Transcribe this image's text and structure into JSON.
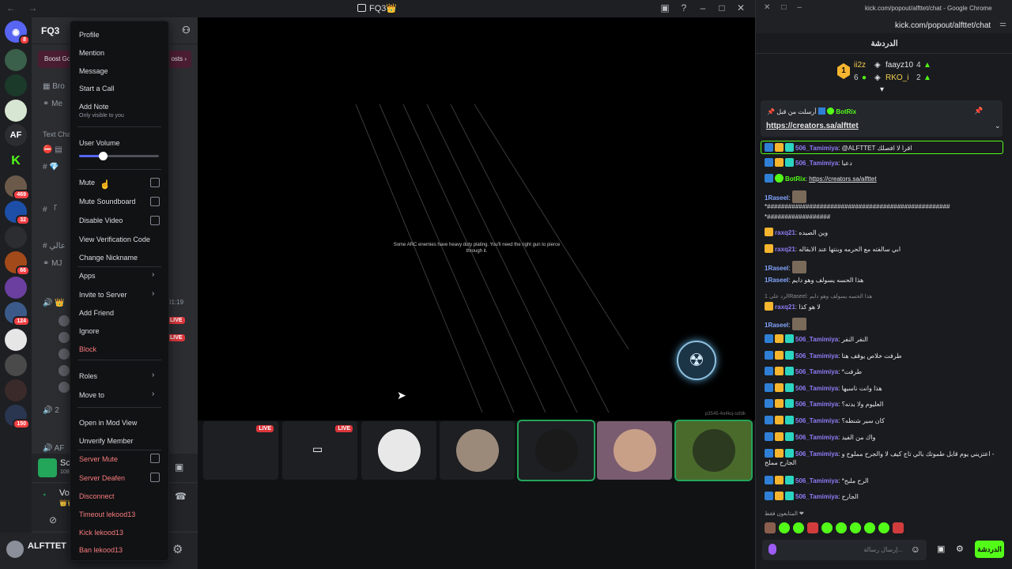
{
  "discord": {
    "window_title": "FQ3👑",
    "server_name": "FQ3",
    "boost_text": "Boost Go",
    "boosts_text": "osts ›",
    "channels": [
      {
        "text": "Bro"
      },
      {
        "text": "Me"
      },
      {
        "text": "Text Cha"
      },
      {
        "text": "Voice Conn"
      }
    ],
    "timer": "01:19",
    "guild_badges": [
      "8",
      "469",
      "32",
      "66",
      "124",
      "150"
    ],
    "guild_letters": [
      "AF"
    ],
    "screen_panel": {
      "title": "Screen 1",
      "subtitle": "1080p 60FPS"
    },
    "voice_panel": {
      "title": "Voice Conne",
      "subtitle": "👑👑 / FQ3"
    },
    "user": {
      "name": "ALFTTET"
    },
    "stream": {
      "caption": "Some ARC enemies have heavy duty plating. You'll need the right gun to pierce through it.",
      "stream_id": "p3545-4o4kq-sxfdk"
    },
    "tiles": [
      {
        "live": "LIVE",
        "speaking": false,
        "color": "#0c0c0c"
      },
      {
        "live": "LIVE",
        "speaking": false,
        "color": "#1a1c20"
      },
      {
        "live": "",
        "speaking": false,
        "color": "#1e1f22"
      },
      {
        "live": "",
        "speaking": false,
        "color": "#c9c9c9"
      },
      {
        "live": "",
        "speaking": true,
        "color": "#101010"
      },
      {
        "live": "",
        "speaking": false,
        "color": "#7a5c70"
      },
      {
        "live": "",
        "speaking": true,
        "color": "#5b7a3c"
      }
    ]
  },
  "context_menu": {
    "profile": "Profile",
    "mention": "Mention",
    "message": "Message",
    "start_call": "Start a Call",
    "add_note": "Add Note",
    "add_note_hint": "Only visible to you",
    "user_volume": "User Volume",
    "volume_level": 0.3,
    "mute": "Mute",
    "mute_soundboard": "Mute Soundboard",
    "disable_video": "Disable Video",
    "view_verification": "View Verification Code",
    "change_nickname": "Change Nickname",
    "apps": "Apps",
    "invite": "Invite to Server",
    "add_friend": "Add Friend",
    "ignore": "Ignore",
    "block": "Block",
    "roles": "Roles",
    "move_to": "Move to",
    "mod_view": "Open in Mod View",
    "unverify": "Unverify Member",
    "server_mute": "Server Mute",
    "server_deafen": "Server Deafen",
    "disconnect": "Disconnect",
    "timeout": "Timeout lekood13",
    "kick": "Kick lekood13",
    "ban": "Ban lekood13"
  },
  "chrome": {
    "title": "kick.com/popout/alfttet/chat - Google Chrome",
    "url": "kick.com/popout/alfttet/chat",
    "chat_header": "الدردشة",
    "leaderboard": {
      "rank": "1",
      "first_name": "ii2z",
      "first_score": "6",
      "second_name": "faayz10",
      "second_score": "4",
      "third_name": "RKO_i",
      "third_score": "2"
    },
    "pinned": {
      "header_prefix": "أرسلت من قبل",
      "bot_name": "BotRix",
      "link": "https://creators.sa/alfttet"
    },
    "messages": [
      {
        "user": "506_Tamimiya",
        "text": "@ALFTTET اقرا لا افصلك",
        "highlight": true
      },
      {
        "user": "506_Tamimiya",
        "text": "دعبا"
      },
      {
        "user": "BotRix",
        "text": "https://creators.sa/alfttet"
      },
      {
        "user": "1Raseel",
        "text": ""
      },
      {
        "user": "",
        "text": "*####################################################"
      },
      {
        "user": "",
        "text": "*##################"
      },
      {
        "user": "raxq21",
        "text": "وين الصيده"
      },
      {
        "user": "raxq21",
        "text": "ابي سالفته مع الحرمه وبنتها عند الابقاله"
      },
      {
        "user": "1Raseel",
        "text": ""
      },
      {
        "user": "1Raseel",
        "text": "هذا الحسه يسولف وهو دايم"
      },
      {
        "user": "raxq21",
        "text": "لا هو كذا"
      },
      {
        "user": "1Raseel",
        "text": ""
      },
      {
        "user": "506_Tamimiya",
        "text": "النفر النفر"
      },
      {
        "user": "506_Tamimiya",
        "text": "طرفت خلاص يوقف هنا"
      },
      {
        "user": "506_Tamimiya",
        "text": "*طرفت"
      },
      {
        "user": "506_Tamimiya",
        "text": "هذا وانت ناسيها"
      },
      {
        "user": "506_Tamimiya",
        "text": "العليوم ولا بدنه؟"
      },
      {
        "user": "506_Tamimiya",
        "text": "كان سير شنطه؟"
      },
      {
        "user": "506_Tamimiya",
        "text": "واك من الفيد"
      },
      {
        "user": "506_Tamimiya",
        "text": "اعتزيني يوم قابل طموتك بالي تاج كيف لا والجرح مملوح و -"
      },
      {
        "user": "",
        "text": "الجارح مملح"
      },
      {
        "user": "506_Tamimiya",
        "text": "*الرح ملبح"
      },
      {
        "user": "506_Tamimiya",
        "text": "الجارح"
      }
    ],
    "reply_hint": "الرد على 1Raseel: هذا الحسه يسولف وهو دايم",
    "emotes_label": "المتابعون فقط ❤",
    "input_placeholder": "إرسال رسالة...",
    "send_label": "الدردشة"
  }
}
